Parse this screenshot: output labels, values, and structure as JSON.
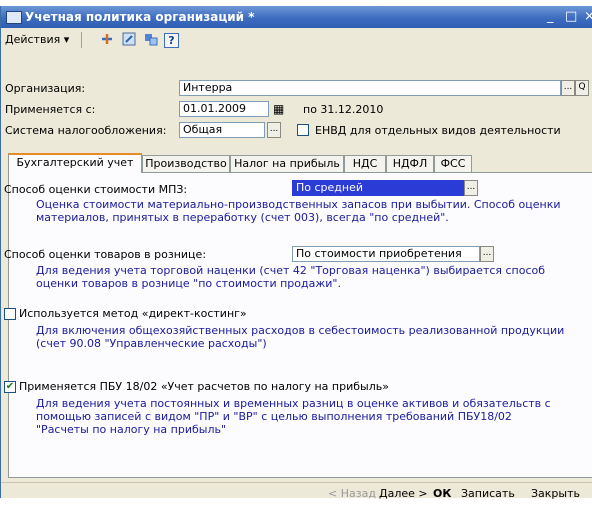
{
  "window": {
    "title": "Учетная политика организаций *",
    "minimize_glyph": "_",
    "maximize_glyph": "□",
    "close_glyph": "×"
  },
  "toolbar": {
    "actions_label": "Действия",
    "actions_arrow": "▾",
    "help_glyph": "?"
  },
  "form": {
    "org_label": "Организация:",
    "org_value": "Интерра",
    "applies_label": "Применяется с:",
    "applies_value": "01.01.2009",
    "applies_to": "по 31.12.2010",
    "tax_label": "Система налогообложения:",
    "tax_value": "Общая",
    "envd_label": "ЕНВД для отдельных видов деятельности",
    "dots": "...",
    "search_glyph": "Q",
    "calendar_glyph": "▦"
  },
  "tabs": [
    {
      "label": "Бухгалтерский учет"
    },
    {
      "label": "Производство"
    },
    {
      "label": "Налог на прибыль"
    },
    {
      "label": "НДС"
    },
    {
      "label": "НДФЛ"
    },
    {
      "label": "ФСС"
    }
  ],
  "panel": {
    "mpz_label": "Способ оценки стоимости МПЗ:",
    "mpz_value": "По средней",
    "mpz_note_1": "Оценка стоимости материально-производственных запасов при выбытии. Способ оценки",
    "mpz_note_2": "материалов, принятых в переработку (счет 003), всегда \"по средней\".",
    "retail_label": "Способ оценки товаров в рознице:",
    "retail_value": "По стоимости приобретения",
    "retail_note_1": "Для ведения учета торговой наценки (счет 42 \"Торговая наценка\") выбирается способ",
    "retail_note_2": "оценки товаров в рознице \"по стоимости продажи\".",
    "direct_label": "Используется метод «директ-костинг»",
    "direct_checked": false,
    "direct_note_1": "Для включения общехозяйственных расходов в себестоимость реализованной продукции",
    "direct_note_2": "(счет 90.08 \"Управленческие расходы\")",
    "pbu_label": "Применяется ПБУ 18/02 «Учет расчетов по налогу на прибыль»",
    "pbu_checked": true,
    "pbu_check_glyph": "✔",
    "pbu_note_1": "Для ведения учета постоянных и временных разниц в оценке активов и обязательств с",
    "pbu_note_2": "помощью записей с видом \"ПР\" и \"ВР\" с целью выполнения требований ПБУ18/02",
    "pbu_note_3": "\"Расчеты по налогу на прибыль\""
  },
  "bottom": {
    "back": "< Назад",
    "next": "Далее >",
    "ok": "ОК",
    "save": "Записать",
    "close": "Закрыть"
  }
}
